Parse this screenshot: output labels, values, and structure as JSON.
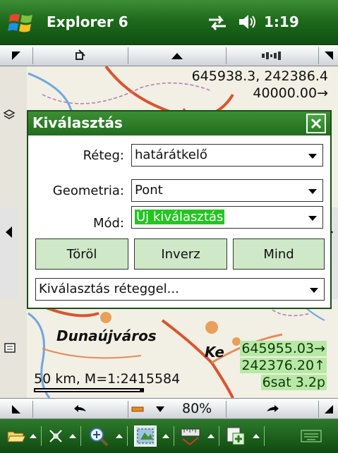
{
  "status_bar": {
    "app_title": "Explorer 6",
    "time": "1:19",
    "icons": [
      "windows-start-icon",
      "sync-icon",
      "volume-icon"
    ]
  },
  "map": {
    "coords_top": [
      "645938.3, 242386.4",
      "40000.00→"
    ],
    "scale": "50 km, M=1:2415584",
    "city_label": "Dunaújváros",
    "ke_label": "Ke",
    "gps_lines": [
      "645955.03→",
      "242376.20↑",
      "6sat 3.2p"
    ]
  },
  "dialog": {
    "title": "Kiválasztás",
    "layer_label": "Réteg:",
    "layer_value": "határátkelő",
    "geometry_label": "Geometria:",
    "geometry_value": "Pont",
    "mode_label": "Mód:",
    "mode_value": "Új kiválasztás",
    "clear_button": "Töröl",
    "invert_button": "Inverz",
    "all_button": "Mind",
    "by_layer_option": "Kiválasztás réteggel..."
  },
  "bottom_toolbar": {
    "zoom": "80%"
  },
  "colors": {
    "titlebar": "#1e6b1c",
    "dialog_title": "#2f7f2a",
    "button_fill": "#cfe8c8",
    "highlight": "#22c61f",
    "gps_bg": "#b8e8a5"
  }
}
